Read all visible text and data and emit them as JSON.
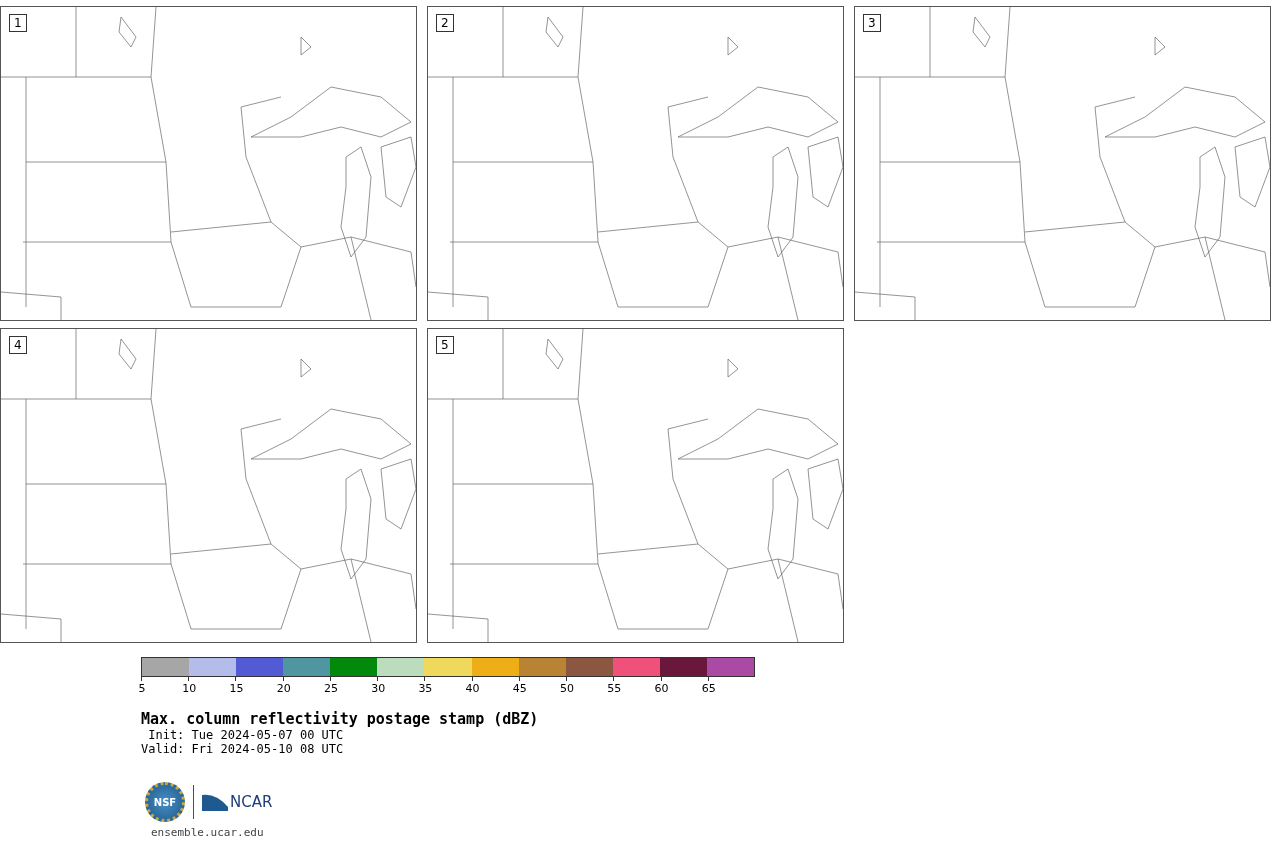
{
  "panels": [
    {
      "label": "1"
    },
    {
      "label": "2"
    },
    {
      "label": "3"
    },
    {
      "label": "4"
    },
    {
      "label": "5"
    }
  ],
  "colorbar": {
    "segments": [
      {
        "color": "#a6a6a6",
        "tick": "5"
      },
      {
        "color": "#b4bdea",
        "tick": "10"
      },
      {
        "color": "#525ad4",
        "tick": "15"
      },
      {
        "color": "#4f96a0",
        "tick": "20"
      },
      {
        "color": "#02880a",
        "tick": "25"
      },
      {
        "color": "#bcdcbe",
        "tick": "30"
      },
      {
        "color": "#efd95c",
        "tick": "35"
      },
      {
        "color": "#edae18",
        "tick": "40"
      },
      {
        "color": "#b88332",
        "tick": "45"
      },
      {
        "color": "#8c5740",
        "tick": "50"
      },
      {
        "color": "#f0517a",
        "tick": "55"
      },
      {
        "color": "#69173a",
        "tick": "60"
      },
      {
        "color": "#aa4aa5",
        "tick": "65"
      }
    ]
  },
  "title": "Max. column reflectivity postage stamp (dBZ)",
  "init": " Init: Tue 2024-05-07 00 UTC",
  "valid": "Valid: Fri 2024-05-10 08 UTC",
  "logo": {
    "left": "NSF",
    "right": "NCAR"
  },
  "footer": "ensemble.ucar.edu"
}
